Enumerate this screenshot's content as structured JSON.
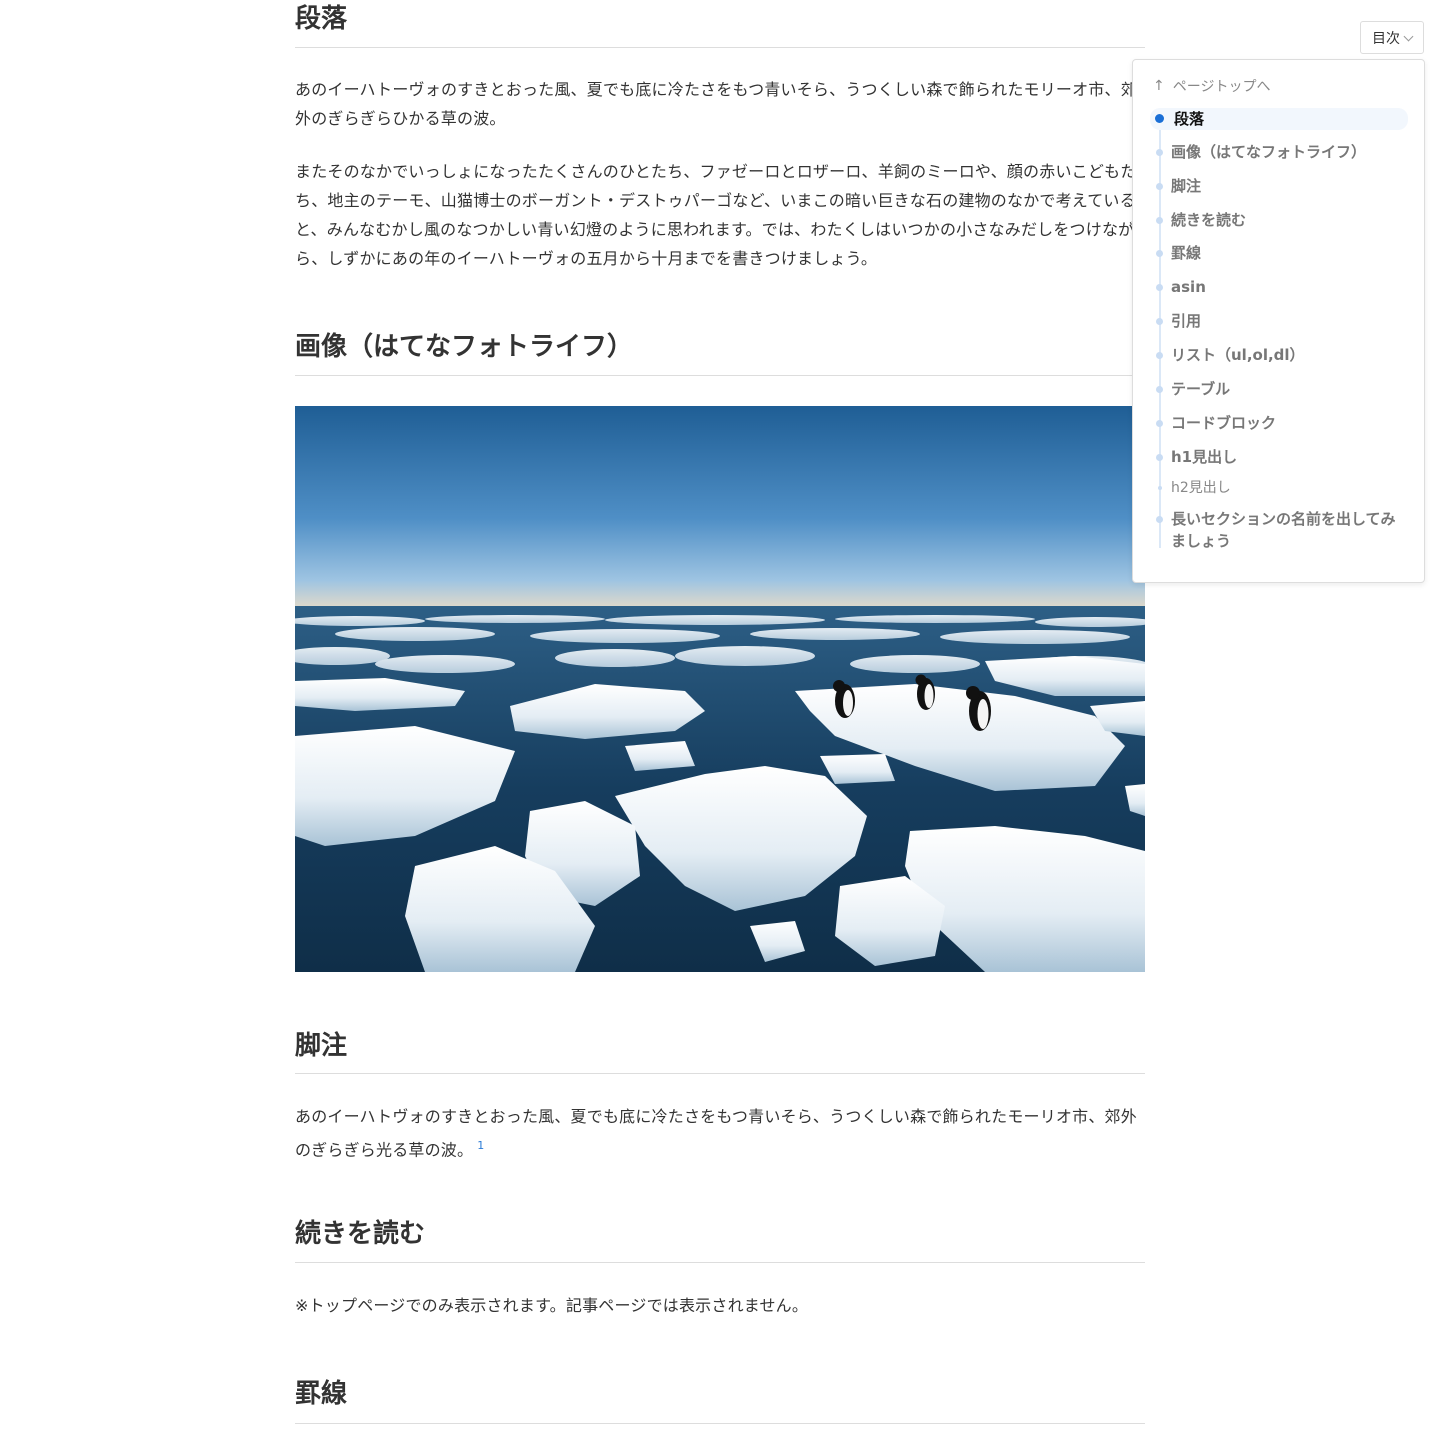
{
  "article": {
    "paragraph_section": {
      "heading": "段落",
      "p1": "あのイーハトーヴォのすきとおった風、夏でも底に冷たさをもつ青いそら、うつくしい森で飾られたモリーオ市、郊外のぎらぎらひかる草の波。",
      "p2": "またそのなかでいっしょになったたくさんのひとたち、ファゼーロとロザーロ、羊飼のミーロや、顔の赤いこどもたち、地主のテーモ、山猫博士のボーガント・デストゥパーゴなど、いまこの暗い巨きな石の建物のなかで考えていると、みんなむかし風のなつかしい青い幻燈のように思われます。では、わたくしはいつかの小さなみだしをつけながら、しずかにあの年のイーハトーヴォの五月から十月までを書きつけましょう。"
    },
    "image_section": {
      "heading": "画像（はてなフォトライフ）"
    },
    "footnote_section": {
      "heading": "脚注",
      "p": "あのイーハトヴォのすきとおった風、夏でも底に冷たさをもつ青いそら、うつくしい森で飾られたモーリオ市、郊外のぎらぎら光る草の波。",
      "footnote_ref": "1"
    },
    "readmore_section": {
      "heading": "続きを読む",
      "p": "※トップページでのみ表示されます。記事ページでは表示されません。"
    },
    "rule_section": {
      "heading": "罫線"
    }
  },
  "toc": {
    "toggle_label": "目次",
    "back_to_top": "ページトップへ",
    "items": [
      {
        "label": "段落",
        "active": true
      },
      {
        "label": "画像（はてなフォトライフ）"
      },
      {
        "label": "脚注"
      },
      {
        "label": "続きを読む"
      },
      {
        "label": "罫線"
      },
      {
        "label": "asin"
      },
      {
        "label": "引用"
      },
      {
        "label": "リスト（ul,ol,dl）"
      },
      {
        "label": "テーブル"
      },
      {
        "label": "コードブロック"
      },
      {
        "label": "h1見出し"
      },
      {
        "label": "h2見出し",
        "sub": true
      },
      {
        "label": "長いセクションの名前を出してみましょう"
      }
    ]
  },
  "colors": {
    "accent": "#1a6fd6",
    "toc_line": "#dbe8f7",
    "text": "#333333",
    "muted": "#777777"
  }
}
